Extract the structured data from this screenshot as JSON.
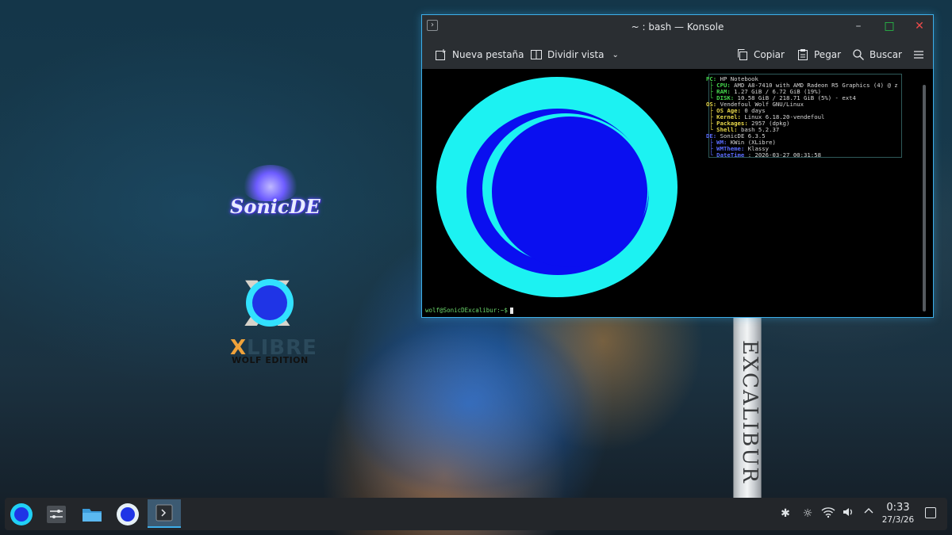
{
  "wallpaper": {
    "sword_text": "EXCALIBUR"
  },
  "desktop_icons": {
    "sonicde": {
      "label": "SonicDE"
    },
    "xlibre": {
      "x": "X",
      "word_x": "X",
      "word_rest": "LIBRE",
      "edition": "WOLF EDITION"
    }
  },
  "window": {
    "title": "~ : bash — Konsole",
    "toolbar": {
      "new_tab": "Nueva pestaña",
      "split_view": "Dividir vista",
      "copy": "Copiar",
      "paste": "Pegar",
      "search": "Buscar"
    },
    "terminal": {
      "fetch_lines": [
        {
          "label": "PC:",
          "value": " HP Notebook",
          "color": "#46d84d"
        },
        {
          "label": " ├ CPU:",
          "value": " AMD A8-7410 with AMD Radeon R5 Graphics (4) @ z",
          "color": "#46d84d"
        },
        {
          "label": " ├ RAM:",
          "value": " 1.27 GiB / 6.72 GiB (19%)",
          "color": "#46d84d"
        },
        {
          "label": " └ DISK:",
          "value": " 10.58 GiB / 218.71 GiB (5%) - ext4",
          "color": "#46d84d"
        },
        {
          "label": "OS:",
          "value": " Vendefoul Wolf GNU/Linux",
          "color": "#e8d84a"
        },
        {
          "label": " ├ OS Age:",
          "value": " 0 days",
          "color": "#e8d84a"
        },
        {
          "label": " ├ Kernel:",
          "value": " Linux 6.18.20-vendefoul",
          "color": "#e8d84a"
        },
        {
          "label": " ├ Packages:",
          "value": " 2957 (dpkg)",
          "color": "#e8d84a"
        },
        {
          "label": " └ Shell:",
          "value": " bash 5.2.37",
          "color": "#e8d84a"
        },
        {
          "label": "DE:",
          "value": " SonicDE 6.3.5",
          "color": "#5a6cff"
        },
        {
          "label": " ├ WM:",
          "value": " KWin (XLibre)",
          "color": "#5a6cff"
        },
        {
          "label": " ├ WMTheme:",
          "value": " Klassy",
          "color": "#5a6cff"
        },
        {
          "label": " └ DateTime",
          "value": " : 2026-03-27 00:31:58",
          "color": "#5a6cff"
        }
      ],
      "prompt": "wolf@SonicDExcalibur:~$"
    }
  },
  "taskbar": {
    "clock_time": "0:33",
    "clock_date": "27/3/26"
  },
  "colors": {
    "accent": "#3daee9",
    "logo_cyan": "#1cf2f2",
    "logo_blue": "#0a0ff0"
  }
}
